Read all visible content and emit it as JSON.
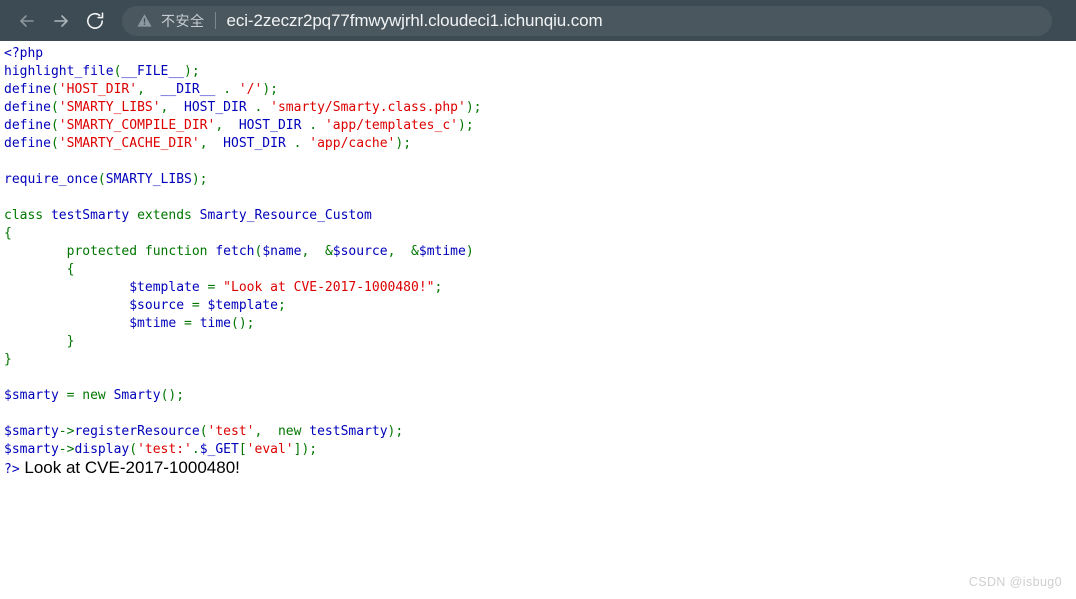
{
  "browser": {
    "nav": {
      "back_icon": "arrow-left-icon",
      "forward_icon": "arrow-right-icon",
      "reload_icon": "reload-icon"
    },
    "address_bar": {
      "security_icon": "warning-triangle-icon",
      "security_label": "不安全",
      "url": "eci-2zeczr2pq77fmwywjrhl.cloudeci1.ichunqiu.com"
    },
    "colors": {
      "toolbar_bg": "#3d4b54",
      "address_bar_bg": "#4a575f",
      "url_text": "#f1f3f4",
      "security_text": "#c6ccd0"
    }
  },
  "page": {
    "background": "#ffffff",
    "syntax_colors": {
      "default": "#0000BB",
      "keyword": "#007700",
      "string": "#DD0000"
    },
    "code_lines": [
      [
        {
          "t": "<?php",
          "c": "b"
        }
      ],
      [
        {
          "t": "highlight_file",
          "c": "b"
        },
        {
          "t": "(",
          "c": "g"
        },
        {
          "t": "__FILE__",
          "c": "b"
        },
        {
          "t": ")",
          "c": "g"
        },
        {
          "t": ";",
          "c": "g"
        }
      ],
      [
        {
          "t": "define",
          "c": "b"
        },
        {
          "t": "(",
          "c": "g"
        },
        {
          "t": "'HOST_DIR'",
          "c": "r"
        },
        {
          "t": ", ",
          "c": "g"
        },
        {
          "t": " __DIR__ ",
          "c": "b"
        },
        {
          "t": ".",
          "c": "g"
        },
        {
          "t": " ",
          "c": "b"
        },
        {
          "t": "'/'",
          "c": "r"
        },
        {
          "t": ")",
          "c": "g"
        },
        {
          "t": ";",
          "c": "g"
        }
      ],
      [
        {
          "t": "define",
          "c": "b"
        },
        {
          "t": "(",
          "c": "g"
        },
        {
          "t": "'SMARTY_LIBS'",
          "c": "r"
        },
        {
          "t": ", ",
          "c": "g"
        },
        {
          "t": " HOST_DIR ",
          "c": "b"
        },
        {
          "t": ".",
          "c": "g"
        },
        {
          "t": " ",
          "c": "b"
        },
        {
          "t": "'smarty/Smarty.class.php'",
          "c": "r"
        },
        {
          "t": ")",
          "c": "g"
        },
        {
          "t": ";",
          "c": "g"
        }
      ],
      [
        {
          "t": "define",
          "c": "b"
        },
        {
          "t": "(",
          "c": "g"
        },
        {
          "t": "'SMARTY_COMPILE_DIR'",
          "c": "r"
        },
        {
          "t": ", ",
          "c": "g"
        },
        {
          "t": " HOST_DIR ",
          "c": "b"
        },
        {
          "t": ".",
          "c": "g"
        },
        {
          "t": " ",
          "c": "b"
        },
        {
          "t": "'app/templates_c'",
          "c": "r"
        },
        {
          "t": ")",
          "c": "g"
        },
        {
          "t": ";",
          "c": "g"
        }
      ],
      [
        {
          "t": "define",
          "c": "b"
        },
        {
          "t": "(",
          "c": "g"
        },
        {
          "t": "'SMARTY_CACHE_DIR'",
          "c": "r"
        },
        {
          "t": ", ",
          "c": "g"
        },
        {
          "t": " HOST_DIR ",
          "c": "b"
        },
        {
          "t": ".",
          "c": "g"
        },
        {
          "t": " ",
          "c": "b"
        },
        {
          "t": "'app/cache'",
          "c": "r"
        },
        {
          "t": ")",
          "c": "g"
        },
        {
          "t": ";",
          "c": "g"
        }
      ],
      [],
      [
        {
          "t": "require_once",
          "c": "b"
        },
        {
          "t": "(",
          "c": "g"
        },
        {
          "t": "SMARTY_LIBS",
          "c": "b"
        },
        {
          "t": ")",
          "c": "g"
        },
        {
          "t": ";",
          "c": "g"
        }
      ],
      [],
      [
        {
          "t": "class",
          "c": "g"
        },
        {
          "t": " testSmarty ",
          "c": "b"
        },
        {
          "t": "extends",
          "c": "g"
        },
        {
          "t": " Smarty_Resource_Custom",
          "c": "b"
        }
      ],
      [
        {
          "t": "{",
          "c": "g"
        }
      ],
      [
        {
          "t": "        ",
          "c": "b"
        },
        {
          "t": "protected function",
          "c": "g"
        },
        {
          "t": " fetch",
          "c": "b"
        },
        {
          "t": "(",
          "c": "g"
        },
        {
          "t": "$name",
          "c": "b"
        },
        {
          "t": ", ",
          "c": "g"
        },
        {
          "t": " ",
          "c": "b"
        },
        {
          "t": "&",
          "c": "g"
        },
        {
          "t": "$source",
          "c": "b"
        },
        {
          "t": ", ",
          "c": "g"
        },
        {
          "t": " ",
          "c": "b"
        },
        {
          "t": "&",
          "c": "g"
        },
        {
          "t": "$mtime",
          "c": "b"
        },
        {
          "t": ")",
          "c": "g"
        }
      ],
      [
        {
          "t": "        ",
          "c": "b"
        },
        {
          "t": "{",
          "c": "g"
        }
      ],
      [
        {
          "t": "                ",
          "c": "b"
        },
        {
          "t": "$template",
          "c": "b"
        },
        {
          "t": " ",
          "c": "b"
        },
        {
          "t": "=",
          "c": "g"
        },
        {
          "t": " ",
          "c": "b"
        },
        {
          "t": "\"Look at CVE-2017-1000480!\"",
          "c": "r"
        },
        {
          "t": ";",
          "c": "g"
        }
      ],
      [
        {
          "t": "                ",
          "c": "b"
        },
        {
          "t": "$source",
          "c": "b"
        },
        {
          "t": " ",
          "c": "b"
        },
        {
          "t": "=",
          "c": "g"
        },
        {
          "t": " ",
          "c": "b"
        },
        {
          "t": "$template",
          "c": "b"
        },
        {
          "t": ";",
          "c": "g"
        }
      ],
      [
        {
          "t": "                ",
          "c": "b"
        },
        {
          "t": "$mtime",
          "c": "b"
        },
        {
          "t": " ",
          "c": "b"
        },
        {
          "t": "=",
          "c": "g"
        },
        {
          "t": " ",
          "c": "b"
        },
        {
          "t": "time",
          "c": "b"
        },
        {
          "t": "()",
          "c": "g"
        },
        {
          "t": ";",
          "c": "g"
        }
      ],
      [
        {
          "t": "        ",
          "c": "b"
        },
        {
          "t": "}",
          "c": "g"
        }
      ],
      [
        {
          "t": "}",
          "c": "g"
        }
      ],
      [],
      [
        {
          "t": "$smarty",
          "c": "b"
        },
        {
          "t": " ",
          "c": "b"
        },
        {
          "t": "=",
          "c": "g"
        },
        {
          "t": " ",
          "c": "b"
        },
        {
          "t": "new",
          "c": "g"
        },
        {
          "t": " Smarty",
          "c": "b"
        },
        {
          "t": "()",
          "c": "g"
        },
        {
          "t": ";",
          "c": "g"
        }
      ],
      [],
      [
        {
          "t": "$smarty",
          "c": "b"
        },
        {
          "t": "->",
          "c": "g"
        },
        {
          "t": "registerResource",
          "c": "b"
        },
        {
          "t": "(",
          "c": "g"
        },
        {
          "t": "'test'",
          "c": "r"
        },
        {
          "t": ", ",
          "c": "g"
        },
        {
          "t": " ",
          "c": "b"
        },
        {
          "t": "new",
          "c": "g"
        },
        {
          "t": " testSmarty",
          "c": "b"
        },
        {
          "t": ")",
          "c": "g"
        },
        {
          "t": ";",
          "c": "g"
        }
      ],
      [
        {
          "t": "$smarty",
          "c": "b"
        },
        {
          "t": "->",
          "c": "g"
        },
        {
          "t": "display",
          "c": "b"
        },
        {
          "t": "(",
          "c": "g"
        },
        {
          "t": "'test:'",
          "c": "r"
        },
        {
          "t": ".",
          "c": "g"
        },
        {
          "t": "$_GET",
          "c": "b"
        },
        {
          "t": "[",
          "c": "g"
        },
        {
          "t": "'eval'",
          "c": "r"
        },
        {
          "t": "]",
          "c": "g"
        },
        {
          "t": ")",
          "c": "g"
        },
        {
          "t": ";",
          "c": "g"
        }
      ]
    ],
    "closing_tag": "?>",
    "rendered_output": " Look at CVE-2017-1000480!",
    "watermark": "CSDN @isbug0"
  }
}
